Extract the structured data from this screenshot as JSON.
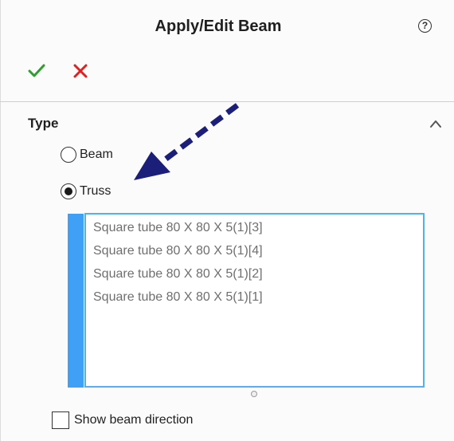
{
  "panel": {
    "title": "Apply/Edit Beam",
    "help_icon": "help-icon",
    "help_glyph": "?",
    "ok_icon": "checkmark-icon",
    "cancel_icon": "close-icon",
    "ok_color": "#2e9e2e",
    "cancel_color": "#e02020"
  },
  "type_section": {
    "title": "Type",
    "collapse_icon": "chevron-up-icon",
    "options": [
      {
        "label": "Beam",
        "selected": false
      },
      {
        "label": "Truss",
        "selected": true
      }
    ],
    "members": [
      "Square tube 80 X 80 X 5(1)[3]",
      "Square tube 80 X 80 X 5(1)[4]",
      "Square tube 80 X 80 X 5(1)[2]",
      "Square tube 80 X 80 X 5(1)[1]"
    ],
    "accent_color": "#3fa0f5",
    "show_direction": {
      "label": "Show beam direction",
      "checked": false
    }
  },
  "annotation": {
    "icon": "dashed-arrow-icon",
    "color": "#1c1f7a"
  }
}
